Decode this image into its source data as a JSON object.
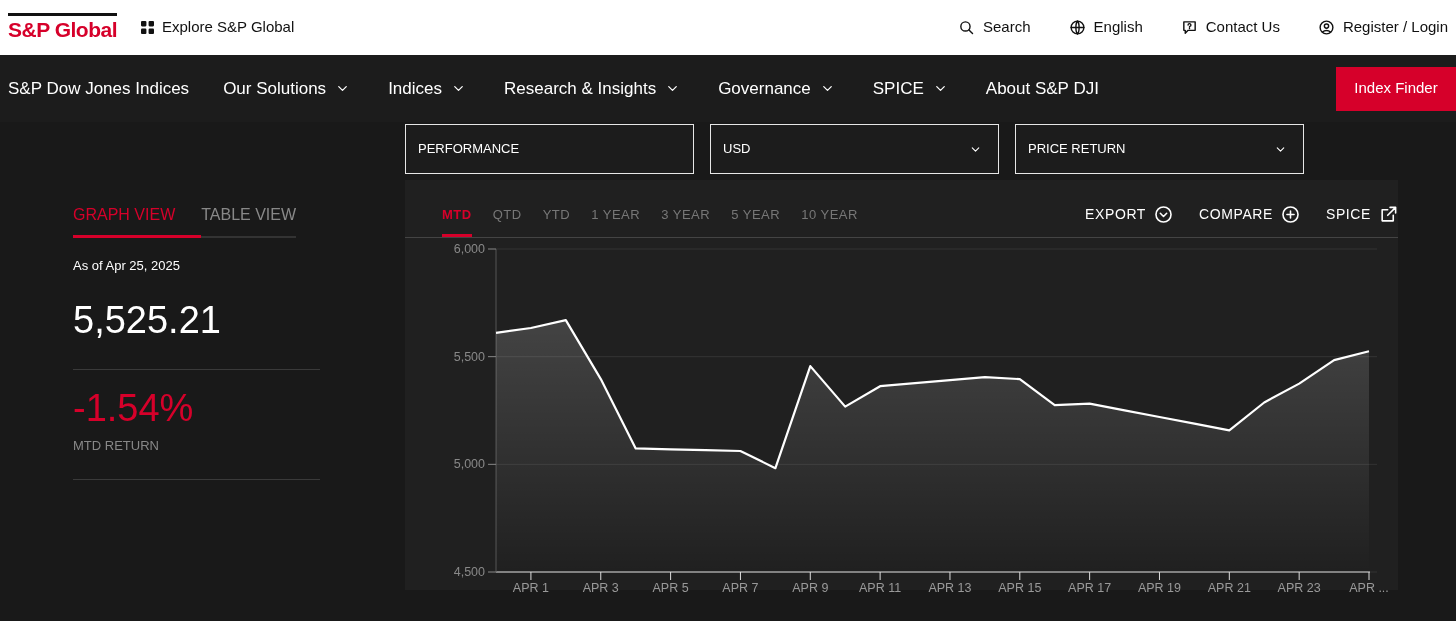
{
  "header": {
    "logo": "S&P Global",
    "explore": "Explore S&P Global",
    "links": [
      {
        "label": "Search"
      },
      {
        "label": "English"
      },
      {
        "label": "Contact Us"
      },
      {
        "label": "Register / Login"
      }
    ]
  },
  "nav": {
    "brand": "S&P Dow Jones Indices",
    "items": [
      {
        "label": "Our Solutions",
        "dropdown": true
      },
      {
        "label": "Indices",
        "dropdown": true
      },
      {
        "label": "Research & Insights",
        "dropdown": true
      },
      {
        "label": "Governance",
        "dropdown": true
      },
      {
        "label": "SPICE",
        "dropdown": true
      },
      {
        "label": "About S&P DJI",
        "dropdown": false
      }
    ],
    "button": "Index Finder"
  },
  "filters": [
    {
      "value": "PERFORMANCE",
      "dropdown": false
    },
    {
      "value": "USD",
      "dropdown": true
    },
    {
      "value": "PRICE RETURN",
      "dropdown": true
    }
  ],
  "view_tabs": [
    {
      "label": "GRAPH VIEW",
      "selected": true
    },
    {
      "label": "TABLE VIEW",
      "selected": false
    }
  ],
  "as_of": "As of Apr 25, 2025",
  "index_value": "5,525.21",
  "return_value": "-1.54%",
  "return_label": "MTD RETURN",
  "periods": [
    {
      "label": "MTD",
      "selected": true
    },
    {
      "label": "QTD",
      "selected": false
    },
    {
      "label": "YTD",
      "selected": false
    },
    {
      "label": "1 YEAR",
      "selected": false
    },
    {
      "label": "3 YEAR",
      "selected": false
    },
    {
      "label": "5 YEAR",
      "selected": false
    },
    {
      "label": "10 YEAR",
      "selected": false
    }
  ],
  "actions": [
    {
      "label": "EXPORT"
    },
    {
      "label": "COMPARE"
    },
    {
      "label": "SPICE"
    }
  ],
  "chart_data": {
    "type": "area",
    "categories": [
      null,
      "APR 1",
      null,
      "APR 3",
      null,
      "APR 5",
      null,
      "APR 7",
      null,
      "APR 9",
      null,
      "APR 11",
      null,
      "APR 13",
      null,
      "APR 15",
      null,
      "APR 17",
      null,
      "APR 19",
      null,
      "APR 21",
      null,
      "APR 23",
      null,
      "APR ..."
    ],
    "series": [
      {
        "color": "#ffffff",
        "values": [
          5611,
          5633,
          5670,
          5396,
          5074,
          5070,
          5066,
          5062,
          4982,
          5456,
          5268,
          5363,
          5377,
          5391,
          5405,
          5396,
          5275,
          5282,
          5251,
          5220,
          5189,
          5158,
          5287,
          5375,
          5484,
          5525
        ]
      }
    ],
    "ylim": [
      4500,
      6000
    ],
    "yticks": [
      {
        "value": 4500,
        "label": "4,500"
      },
      {
        "value": 5000,
        "label": "5,000"
      },
      {
        "value": 5500,
        "label": "5,500"
      },
      {
        "value": 6000,
        "label": "6,000"
      }
    ]
  }
}
